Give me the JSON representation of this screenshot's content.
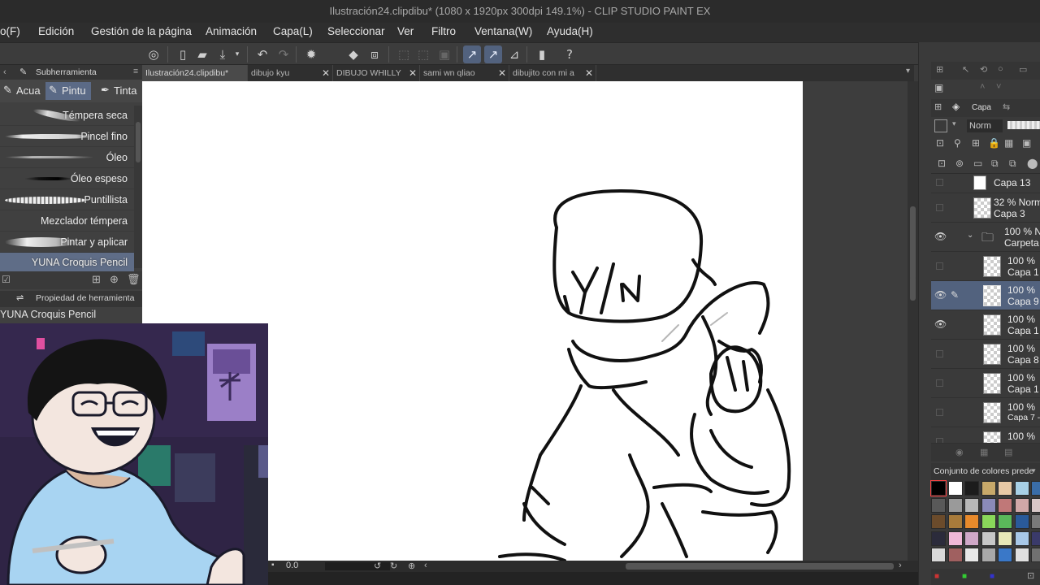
{
  "window": {
    "title": "Ilustración24.clipdibu* (1080 x 1920px 300dpi 149.1%) - CLIP STUDIO PAINT EX"
  },
  "menu": [
    "o(F)",
    "Edición",
    "Gestión de la página",
    "Animación",
    "Capa(L)",
    "Seleccionar",
    "Ver",
    "Filtro",
    "Ventana(W)",
    "Ayuda(H)"
  ],
  "toolbar_icons": [
    "clip-studio-icon",
    "new-icon",
    "open-icon",
    "save-icon",
    "undo-icon",
    "redo-icon",
    "loading-icon",
    "fill-icon",
    "transform-icon",
    "select-icon",
    "ruler-snap-icon",
    "ruler-icon",
    "help-icon"
  ],
  "left": {
    "subtool_header": "Subherramienta",
    "tabs": [
      {
        "label": "Acua",
        "icon": "brush-icon",
        "active": false
      },
      {
        "label": "Pintu",
        "icon": "brush-icon",
        "active": true
      },
      {
        "label": "Tinta",
        "icon": "pen-icon",
        "active": false
      }
    ],
    "brushes": [
      {
        "name": "Témpera seca",
        "selected": false
      },
      {
        "name": "Pincel fino",
        "selected": false
      },
      {
        "name": "Óleo",
        "selected": false
      },
      {
        "name": "Óleo espeso",
        "selected": false
      },
      {
        "name": "Puntillista",
        "selected": false
      },
      {
        "name": "Mezclador témpera",
        "selected": false
      },
      {
        "name": "Pintar y aplicar",
        "selected": false
      },
      {
        "name": "YUNA Croquis Pencil",
        "selected": true
      }
    ],
    "tool_property_header": "Propiedad de herramienta",
    "tool_property_name": "YUNA Croquis Pencil"
  },
  "doc_tabs": [
    {
      "label": "Ilustración24.clipdibu*",
      "active": true,
      "closable": false
    },
    {
      "label": "dibujo kyu",
      "active": false,
      "closable": true
    },
    {
      "label": "DIBUJO WHILLY",
      "active": false,
      "closable": true
    },
    {
      "label": "sami wn qliao",
      "active": false,
      "closable": true
    },
    {
      "label": "dibujito con mi a",
      "active": false,
      "closable": true
    }
  ],
  "canvas": {
    "drawing_text": "Y/N",
    "rotation": "0.0"
  },
  "right": {
    "layer_header": "Capa",
    "blend_mode": "Norm",
    "layers": [
      {
        "mode": "",
        "name": "Capa 13",
        "visible": false,
        "selected": false
      },
      {
        "mode": "32 % Norm",
        "name": "Capa 3",
        "visible": false,
        "selected": false
      },
      {
        "mode": "100 % N",
        "name": "Carpeta",
        "visible": true,
        "selected": false,
        "folder": true
      },
      {
        "mode": "100 %",
        "name": "Capa 1",
        "visible": false,
        "selected": false
      },
      {
        "mode": "100 %",
        "name": "Capa 9",
        "visible": true,
        "selected": true
      },
      {
        "mode": "100 %",
        "name": "Capa 1",
        "visible": true,
        "selected": false
      },
      {
        "mode": "100 %",
        "name": "Capa 8",
        "visible": false,
        "selected": false
      },
      {
        "mode": "100 %",
        "name": "Capa 1",
        "visible": false,
        "selected": false
      },
      {
        "mode": "100 %",
        "name": "Capa 7 -",
        "visible": false,
        "selected": false
      },
      {
        "mode": "100 %",
        "name": "",
        "visible": false,
        "selected": false
      }
    ],
    "color_set_header": "Conjunto de colores prede",
    "swatches": [
      "#000000",
      "#ffffff",
      "#1c1c1c",
      "#c8a96a",
      "#e8c9a6",
      "#a8d0e6",
      "#3a6da8",
      "#595959",
      "#9a9a9a",
      "#b8b8b8",
      "#8a8ab8",
      "#c07878",
      "#d0a8a8",
      "#d8c8c8",
      "#6b4b2b",
      "#a87b3b",
      "#e88a2b",
      "#8ad85a",
      "#5ab85a",
      "#2a5a9a",
      "#7a7a7a",
      "#2b2b3b",
      "#f0b8d8",
      "#d0a8c8",
      "#c8c8c8",
      "#e8e8b8",
      "#a8c8e8",
      "#3a3a6a",
      "#d8d8d8",
      "#a06060",
      "#e8e8e8",
      "#a8a8a8",
      "#3a78c8",
      "#e0e0e0",
      "#707070"
    ]
  }
}
